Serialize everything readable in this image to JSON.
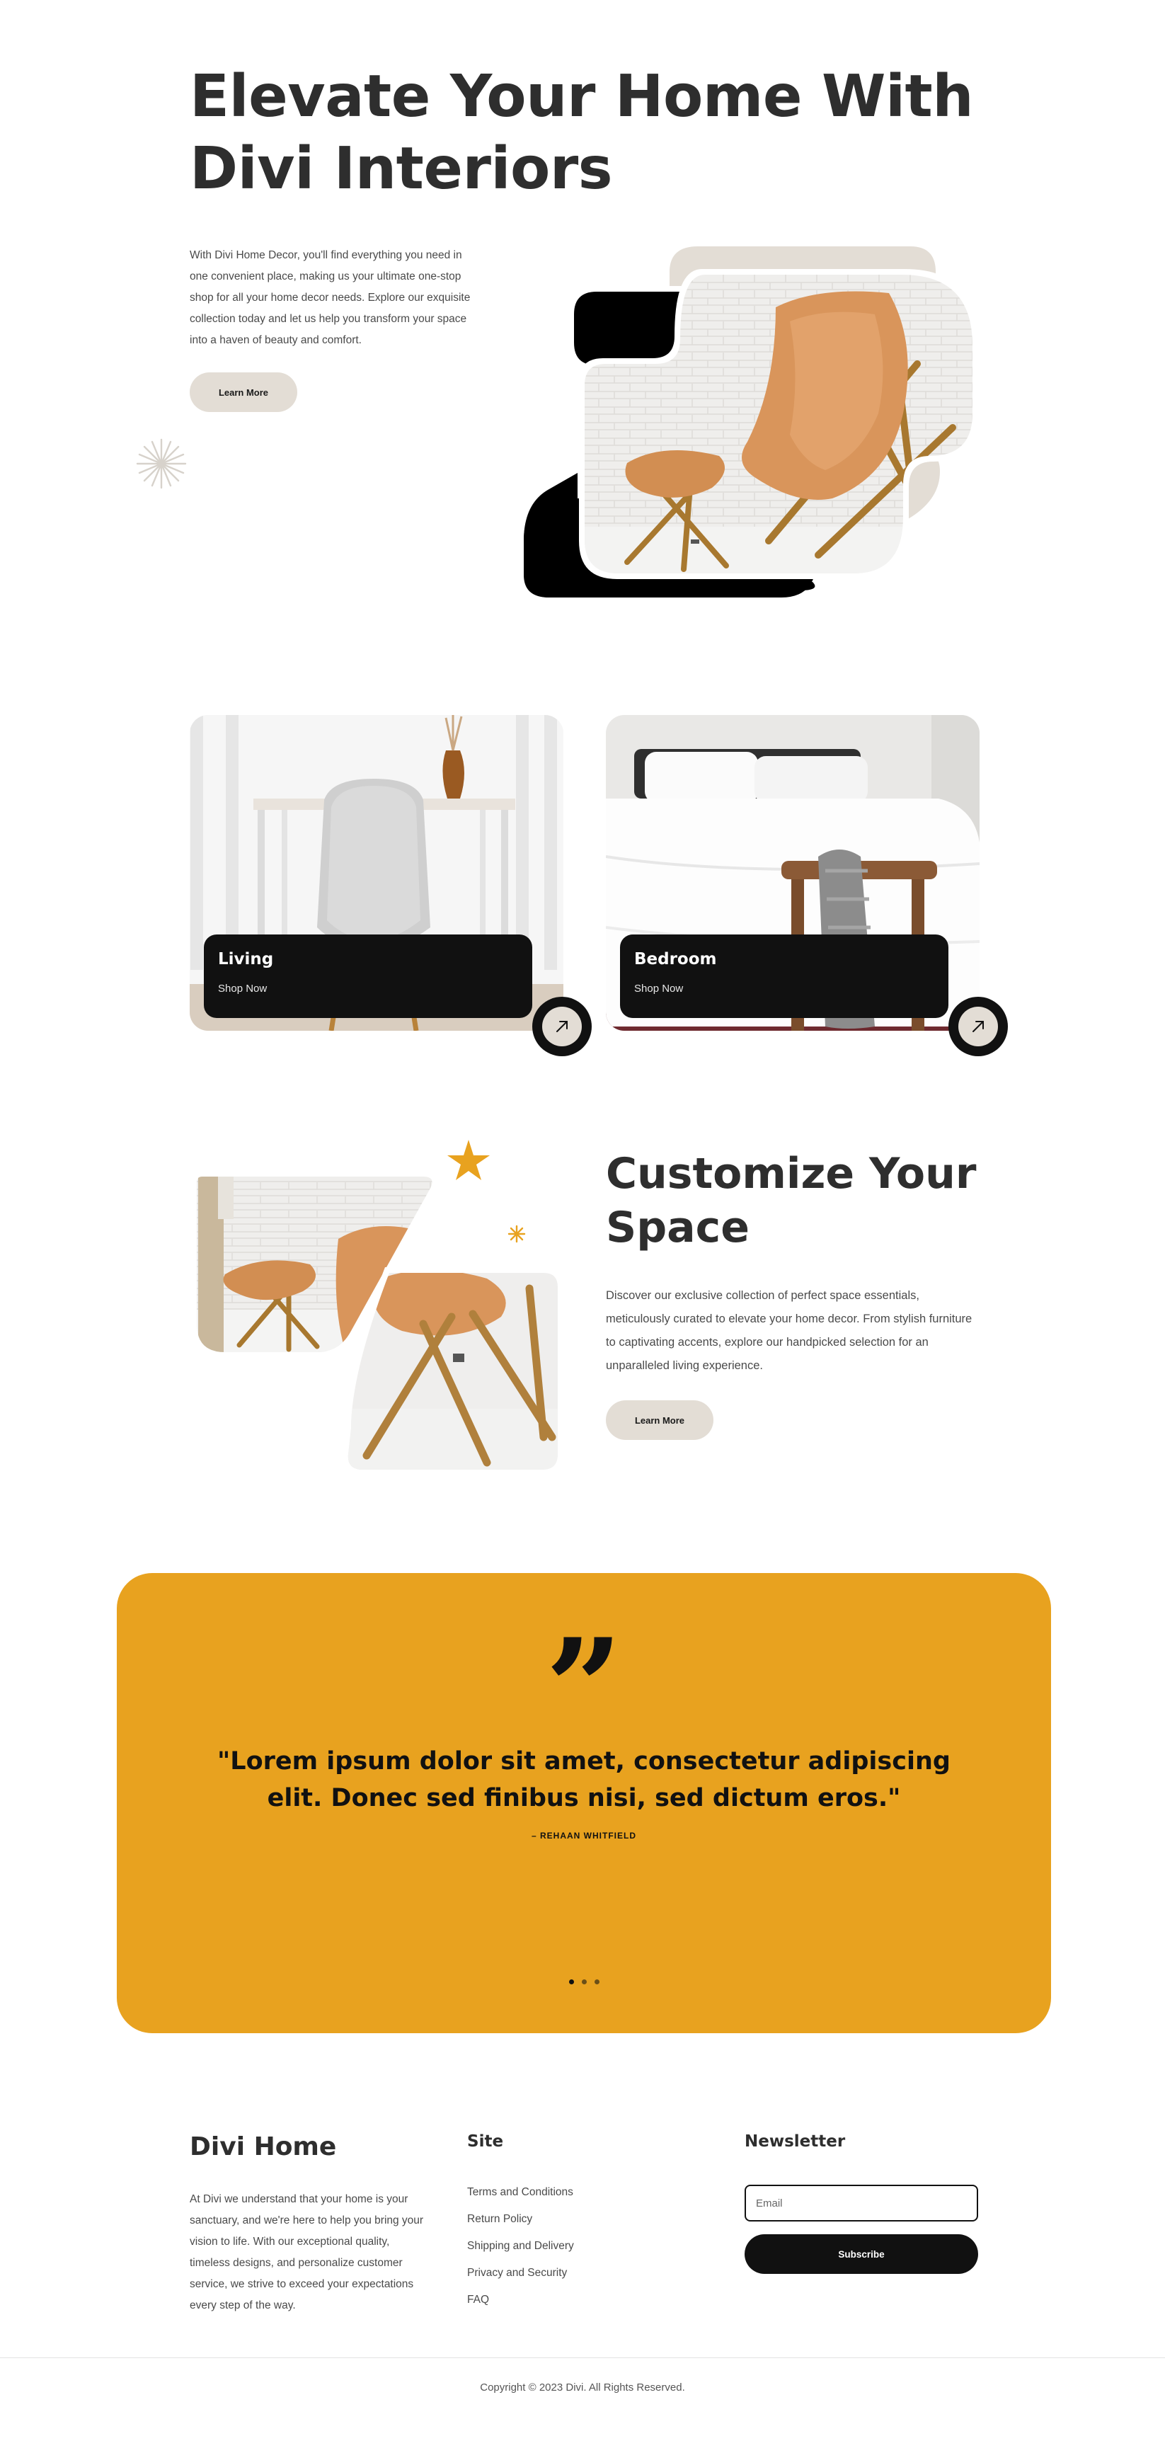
{
  "hero": {
    "title": "Elevate Your Home With Divi Interiors",
    "text": "With Divi Home Decor, you'll find everything you need in one convenient place, making us your ultimate one-stop shop for all your home decor needs. Explore our exquisite collection today and let us help you transform your space into a haven of beauty and comfort.",
    "button_label": "Learn More"
  },
  "categories": [
    {
      "title": "Living",
      "link": "Shop Now"
    },
    {
      "title": "Bedroom",
      "link": "Shop Now"
    }
  ],
  "customize": {
    "title": "Customize Your Space",
    "text": "Discover our exclusive collection of perfect space essentials, meticulously curated to elevate your home decor. From stylish furniture to captivating accents, explore our handpicked selection for an unparalleled living experience.",
    "button_label": "Learn More"
  },
  "testimonial": {
    "quote_mark": "”",
    "quote": "\"Lorem ipsum dolor sit amet, consectetur adipiscing elit. Donec sed finibus nisi, sed dictum eros.\"",
    "author": "– REHAAN WHITFIELD",
    "slides": 3,
    "active_slide": 1
  },
  "footer": {
    "brand": "Divi Home",
    "about": "At Divi we understand that your home is your sanctuary, and we're here to help you bring your vision to life. With our exceptional quality, timeless designs, and personalize customer service, we strive to exceed your expectations every step of the way.",
    "site_heading": "Site",
    "links": [
      "Terms and Conditions",
      "Return Policy",
      "Shipping and Delivery",
      "Privacy and Security",
      "FAQ"
    ],
    "newsletter_heading": "Newsletter",
    "email_placeholder": "Email",
    "subscribe_label": "Subscribe",
    "copyright": "Copyright © 2023 Divi. All Rights Reserved."
  },
  "colors": {
    "accent": "#e8a21f",
    "beige": "#e3ddd5",
    "dark": "#111111",
    "text": "#2e2e2e"
  }
}
